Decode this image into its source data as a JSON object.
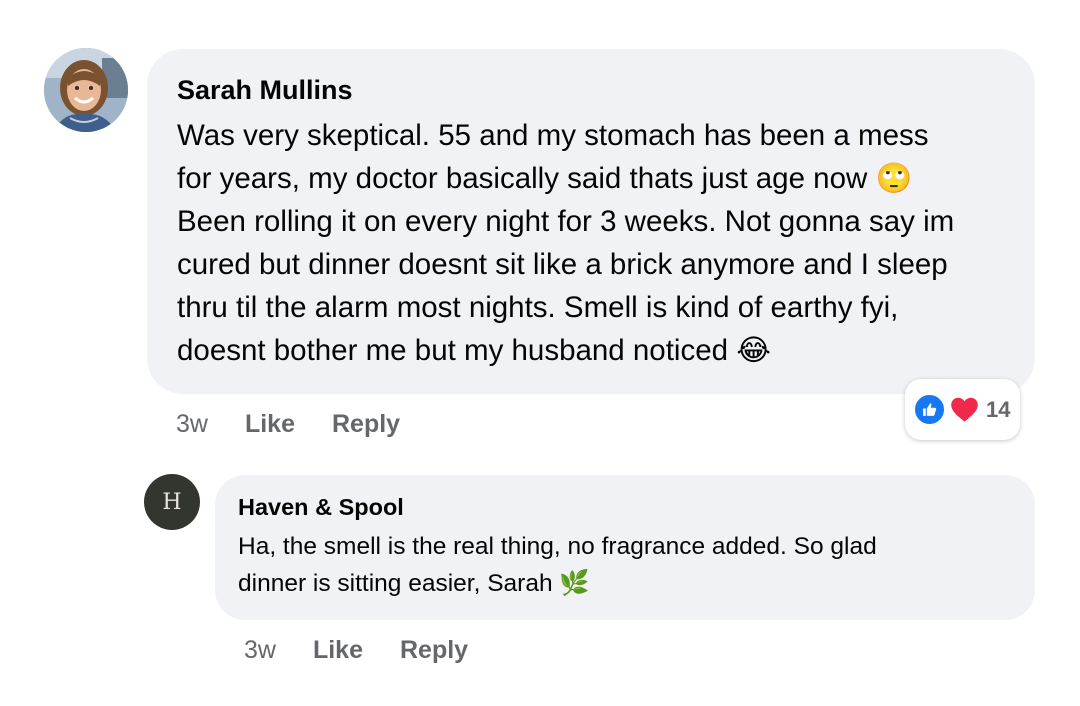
{
  "comment": {
    "author": "Sarah Mullins",
    "avatar_icon": "profile-photo",
    "body_lines": [
      "Was very skeptical. 55 and my stomach has been a mess",
      "for years, my doctor basically said thats just age now",
      "Been rolling it on every night for 3 weeks. Not gonna say im",
      "cured but dinner doesnt sit like a brick anymore and I sleep",
      "thru til the alarm most nights. Smell is kind of earthy fyi,",
      "doesnt bother me but my husband noticed"
    ],
    "emoji_eye_roll": "🙄",
    "emoji_laugh": "😂",
    "time": "3w",
    "like_label": "Like",
    "reply_label": "Reply",
    "reactions": {
      "icons": [
        "like-icon",
        "heart-icon"
      ],
      "count": "14",
      "like_color": "#1877f2",
      "heart_color": "#f02849"
    }
  },
  "reply": {
    "author": "Haven & Spool",
    "avatar_letter": "H",
    "body_lines": [
      "Ha, the smell is the real thing, no fragrance added. So glad",
      "dinner is sitting easier, Sarah"
    ],
    "emoji_leaf": "🌿",
    "time": "3w",
    "like_label": "Like",
    "reply_label": "Reply"
  },
  "colors": {
    "bubble_bg": "#f0f2f5",
    "meta_text": "#65676b",
    "body_text": "#050505"
  }
}
